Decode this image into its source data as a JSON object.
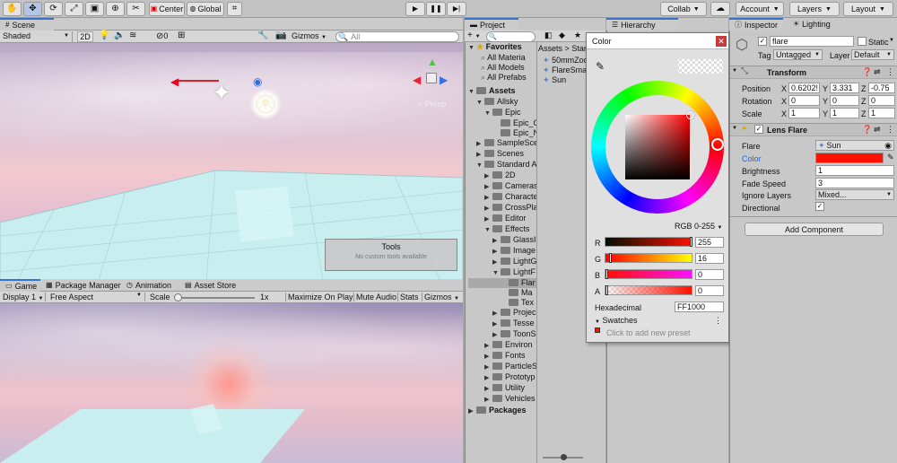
{
  "toolbar": {
    "center_label": "Center",
    "global_label": "Global",
    "collab_label": "Collab",
    "account_label": "Account",
    "layers_label": "Layers",
    "layout_label": "Layout"
  },
  "scene": {
    "tab_label": "Scene",
    "shading_mode": "Shaded",
    "mode_2d": "2D",
    "hidden_count": "0",
    "gizmos_label": "Gizmos",
    "search_placeholder": "All",
    "persp_label": "< Persp",
    "tools_title": "Tools",
    "tools_body": "No custom tools available"
  },
  "game": {
    "tabs": [
      "Game",
      "Package Manager",
      "Animation",
      "Asset Store"
    ],
    "display_label": "Display 1",
    "aspect_label": "Free Aspect",
    "scale_label": "Scale",
    "scale_value": "1x",
    "maximize_label": "Maximize On Play",
    "mute_label": "Mute Audio",
    "stats_label": "Stats",
    "gizmos_label": "Gizmos"
  },
  "project": {
    "tab_label": "Project",
    "favorites_label": "Favorites",
    "favorites": [
      "All Materia",
      "All Models",
      "All Prefabs"
    ],
    "assets_label": "Assets",
    "tree": [
      {
        "label": "Allsky",
        "indent": 1,
        "arrow": "▼"
      },
      {
        "label": "Epic",
        "indent": 2,
        "arrow": "▼"
      },
      {
        "label": "Epic_G",
        "indent": 3,
        "arrow": ""
      },
      {
        "label": "Epic_N",
        "indent": 3,
        "arrow": ""
      },
      {
        "label": "SampleSce",
        "indent": 1,
        "arrow": "▶"
      },
      {
        "label": "Scenes",
        "indent": 1,
        "arrow": "▶"
      },
      {
        "label": "Standard A",
        "indent": 1,
        "arrow": "▼"
      },
      {
        "label": "2D",
        "indent": 2,
        "arrow": "▶"
      },
      {
        "label": "Cameras",
        "indent": 2,
        "arrow": "▶"
      },
      {
        "label": "Characte",
        "indent": 2,
        "arrow": "▶"
      },
      {
        "label": "CrossPla",
        "indent": 2,
        "arrow": "▶"
      },
      {
        "label": "Editor",
        "indent": 2,
        "arrow": "▶"
      },
      {
        "label": "Effects",
        "indent": 2,
        "arrow": "▼"
      },
      {
        "label": "GlassI",
        "indent": 3,
        "arrow": "▶"
      },
      {
        "label": "Image",
        "indent": 3,
        "arrow": "▶"
      },
      {
        "label": "LightG",
        "indent": 3,
        "arrow": "▶"
      },
      {
        "label": "LightF",
        "indent": 3,
        "arrow": "▼"
      },
      {
        "label": "Flar",
        "indent": 4,
        "arrow": "",
        "selected": true
      },
      {
        "label": "Ma",
        "indent": 4,
        "arrow": ""
      },
      {
        "label": "Tex",
        "indent": 4,
        "arrow": ""
      },
      {
        "label": "Projec",
        "indent": 3,
        "arrow": "▶"
      },
      {
        "label": "Tesse",
        "indent": 3,
        "arrow": "▶"
      },
      {
        "label": "ToonS",
        "indent": 3,
        "arrow": "▶"
      },
      {
        "label": "Environ",
        "indent": 2,
        "arrow": "▶"
      },
      {
        "label": "Fonts",
        "indent": 2,
        "arrow": "▶"
      },
      {
        "label": "ParticleS",
        "indent": 2,
        "arrow": "▶"
      },
      {
        "label": "Prototyp",
        "indent": 2,
        "arrow": "▶"
      },
      {
        "label": "Utility",
        "indent": 2,
        "arrow": "▶"
      },
      {
        "label": "Vehicles",
        "indent": 2,
        "arrow": "▶"
      }
    ],
    "packages_label": "Packages",
    "breadcrumb_root": "Assets",
    "breadcrumb_sep": ">",
    "breadcrumb_next": "Stand",
    "files": [
      "50mmZoo",
      "FlareSmal",
      "Sun"
    ]
  },
  "hierarchy": {
    "tab_label": "Hierarchy"
  },
  "color_picker": {
    "title": "Color",
    "mode_label": "RGB 0-255",
    "channels": [
      {
        "name": "R",
        "value": "255"
      },
      {
        "name": "G",
        "value": "16"
      },
      {
        "name": "B",
        "value": "0"
      },
      {
        "name": "A",
        "value": "0"
      }
    ],
    "hex_label": "Hexadecimal",
    "hex_value": "FF1000",
    "swatches_label": "Swatches",
    "add_preset_label": "Click to add new preset",
    "current_color": "#ff1000"
  },
  "inspector": {
    "tab_label": "Inspector",
    "lighting_tab_label": "Lighting",
    "object_name": "flare",
    "static_label": "Static",
    "tag_label": "Tag",
    "tag_value": "Untagged",
    "layer_label": "Layer",
    "layer_value": "Default",
    "transform": {
      "title": "Transform",
      "position_label": "Position",
      "position": {
        "x": "0.6202!",
        "y": "3.331",
        "z": "-0.75"
      },
      "rotation_label": "Rotation",
      "rotation": {
        "x": "0",
        "y": "0",
        "z": "0"
      },
      "scale_label": "Scale",
      "scale": {
        "x": "1",
        "y": "1",
        "z": "1"
      }
    },
    "lens_flare": {
      "title": "Lens Flare",
      "flare_label": "Flare",
      "flare_value": "Sun",
      "color_label": "Color",
      "color_value": "#ff1000",
      "brightness_label": "Brightness",
      "brightness_value": "1",
      "fade_label": "Fade Speed",
      "fade_value": "3",
      "ignore_label": "Ignore Layers",
      "ignore_value": "Mixed...",
      "directional_label": "Directional"
    },
    "add_component_label": "Add Component"
  }
}
